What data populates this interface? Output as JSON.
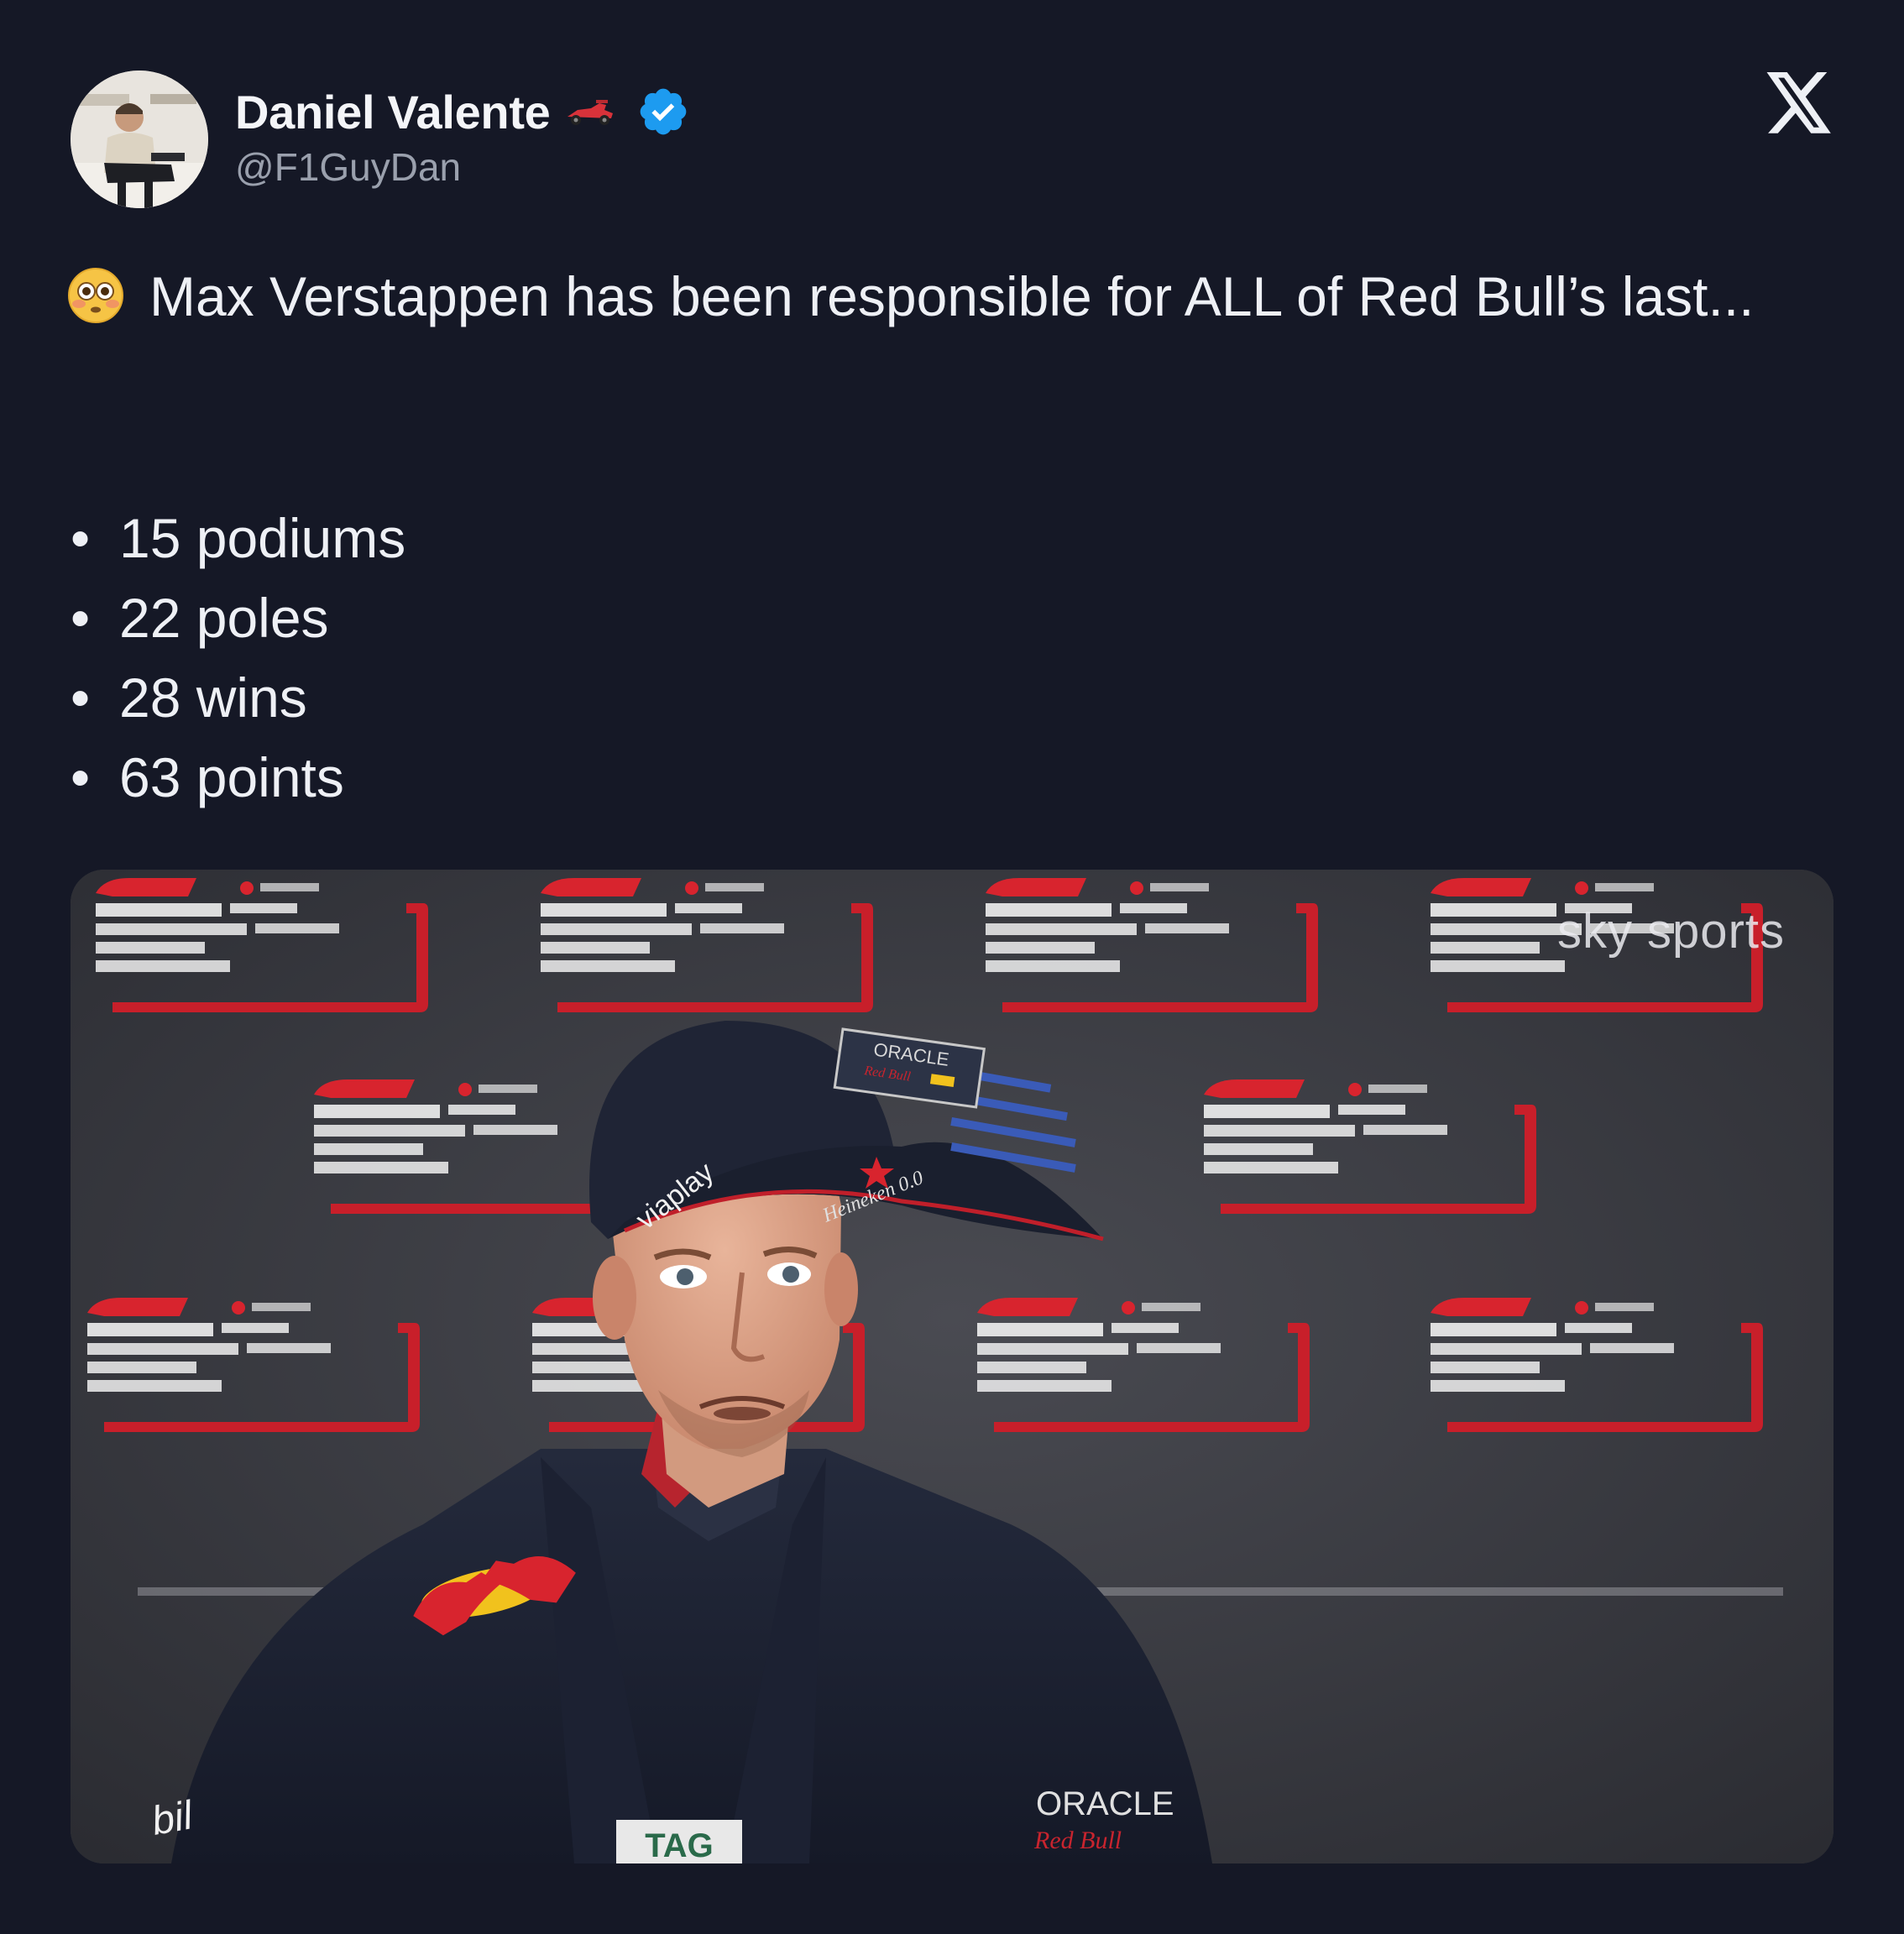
{
  "author": {
    "display_name": "Daniel Valente",
    "handle": "@F1GuyDan",
    "verified": true
  },
  "icons": {
    "emoji_after_name": "racing-car-icon",
    "verified_badge": "verified-badge-icon",
    "platform_logo": "x-logo-icon",
    "tweet_emoji": "flushed-face-icon"
  },
  "tweet": {
    "text_main": "Max Verstappen has been responsible for ALL of Red Bull’s last...",
    "stats": [
      "15 podiums",
      "22 poles",
      "28 wins",
      "63 points"
    ]
  },
  "media": {
    "description_watermark": "sky sports",
    "cap_logo_text": "ORACLE",
    "sponsor_viaplay": "viaplay",
    "sponsor_heineken": "Heineken 0.0",
    "sponsor_tag": "TAG",
    "sponsor_bil": "bil",
    "jacket_oracle": "ORACLE"
  },
  "colors": {
    "background": "#151826",
    "text": "#eef0f5",
    "muted": "#9aa0ad",
    "verified_blue": "#1d9bf0"
  }
}
